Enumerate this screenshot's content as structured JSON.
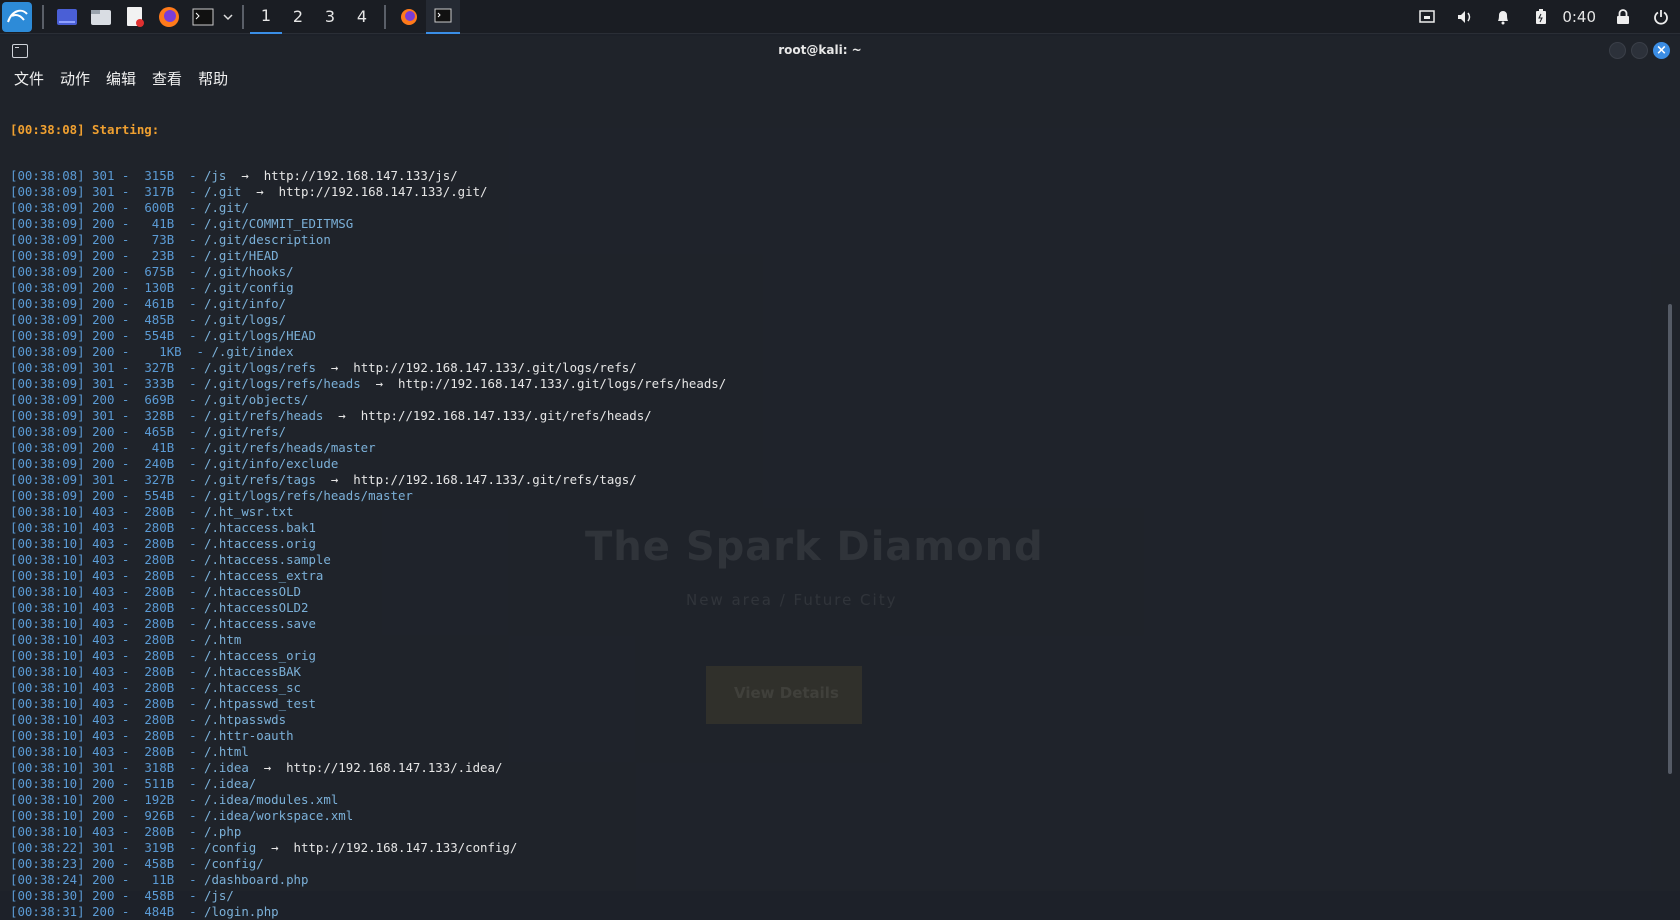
{
  "taskbar": {
    "workspaces": [
      "1",
      "2",
      "3",
      "4"
    ],
    "active_workspace": "1",
    "clock": "0:40",
    "icons": [
      "kali-menu-icon",
      "desktop-icon",
      "file-manager-icon",
      "text-editor-icon",
      "firefox-icon",
      "terminal-icon",
      "dropdown-icon"
    ],
    "tray_icons": [
      "network-icon",
      "volume-icon",
      "notification-icon",
      "battery-icon",
      "lock-icon",
      "power-icon"
    ]
  },
  "window": {
    "title": "root@kali: ~",
    "menu": [
      "文件",
      "动作",
      "编辑",
      "查看",
      "帮助"
    ]
  },
  "terminal": {
    "start_line": "[00:38:08] Starting:",
    "lines": [
      {
        "ts": "[00:38:08]",
        "code": "301",
        "size": " 315B",
        "path": "/js",
        "redirect": "http://192.168.147.133/js/"
      },
      {
        "ts": "[00:38:09]",
        "code": "301",
        "size": " 317B",
        "path": "/.git",
        "redirect": "http://192.168.147.133/.git/"
      },
      {
        "ts": "[00:38:09]",
        "code": "200",
        "size": " 600B",
        "path": "/.git/",
        "redirect": ""
      },
      {
        "ts": "[00:38:09]",
        "code": "200",
        "size": "  41B",
        "path": "/.git/COMMIT_EDITMSG",
        "redirect": ""
      },
      {
        "ts": "[00:38:09]",
        "code": "200",
        "size": "  73B",
        "path": "/.git/description",
        "redirect": ""
      },
      {
        "ts": "[00:38:09]",
        "code": "200",
        "size": "  23B",
        "path": "/.git/HEAD",
        "redirect": ""
      },
      {
        "ts": "[00:38:09]",
        "code": "200",
        "size": " 675B",
        "path": "/.git/hooks/",
        "redirect": ""
      },
      {
        "ts": "[00:38:09]",
        "code": "200",
        "size": " 130B",
        "path": "/.git/config",
        "redirect": ""
      },
      {
        "ts": "[00:38:09]",
        "code": "200",
        "size": " 461B",
        "path": "/.git/info/",
        "redirect": ""
      },
      {
        "ts": "[00:38:09]",
        "code": "200",
        "size": " 485B",
        "path": "/.git/logs/",
        "redirect": ""
      },
      {
        "ts": "[00:38:09]",
        "code": "200",
        "size": " 554B",
        "path": "/.git/logs/HEAD",
        "redirect": ""
      },
      {
        "ts": "[00:38:09]",
        "code": "200",
        "size": "   1KB",
        "path": "/.git/index",
        "redirect": ""
      },
      {
        "ts": "[00:38:09]",
        "code": "301",
        "size": " 327B",
        "path": "/.git/logs/refs",
        "redirect": "http://192.168.147.133/.git/logs/refs/"
      },
      {
        "ts": "[00:38:09]",
        "code": "301",
        "size": " 333B",
        "path": "/.git/logs/refs/heads",
        "redirect": "http://192.168.147.133/.git/logs/refs/heads/"
      },
      {
        "ts": "[00:38:09]",
        "code": "200",
        "size": " 669B",
        "path": "/.git/objects/",
        "redirect": ""
      },
      {
        "ts": "[00:38:09]",
        "code": "301",
        "size": " 328B",
        "path": "/.git/refs/heads",
        "redirect": "http://192.168.147.133/.git/refs/heads/"
      },
      {
        "ts": "[00:38:09]",
        "code": "200",
        "size": " 465B",
        "path": "/.git/refs/",
        "redirect": ""
      },
      {
        "ts": "[00:38:09]",
        "code": "200",
        "size": "  41B",
        "path": "/.git/refs/heads/master",
        "redirect": ""
      },
      {
        "ts": "[00:38:09]",
        "code": "200",
        "size": " 240B",
        "path": "/.git/info/exclude",
        "redirect": ""
      },
      {
        "ts": "[00:38:09]",
        "code": "301",
        "size": " 327B",
        "path": "/.git/refs/tags",
        "redirect": "http://192.168.147.133/.git/refs/tags/"
      },
      {
        "ts": "[00:38:09]",
        "code": "200",
        "size": " 554B",
        "path": "/.git/logs/refs/heads/master",
        "redirect": ""
      },
      {
        "ts": "[00:38:10]",
        "code": "403",
        "size": " 280B",
        "path": "/.ht_wsr.txt",
        "redirect": ""
      },
      {
        "ts": "[00:38:10]",
        "code": "403",
        "size": " 280B",
        "path": "/.htaccess.bak1",
        "redirect": ""
      },
      {
        "ts": "[00:38:10]",
        "code": "403",
        "size": " 280B",
        "path": "/.htaccess.orig",
        "redirect": ""
      },
      {
        "ts": "[00:38:10]",
        "code": "403",
        "size": " 280B",
        "path": "/.htaccess.sample",
        "redirect": ""
      },
      {
        "ts": "[00:38:10]",
        "code": "403",
        "size": " 280B",
        "path": "/.htaccess_extra",
        "redirect": ""
      },
      {
        "ts": "[00:38:10]",
        "code": "403",
        "size": " 280B",
        "path": "/.htaccessOLD",
        "redirect": ""
      },
      {
        "ts": "[00:38:10]",
        "code": "403",
        "size": " 280B",
        "path": "/.htaccessOLD2",
        "redirect": ""
      },
      {
        "ts": "[00:38:10]",
        "code": "403",
        "size": " 280B",
        "path": "/.htaccess.save",
        "redirect": ""
      },
      {
        "ts": "[00:38:10]",
        "code": "403",
        "size": " 280B",
        "path": "/.htm",
        "redirect": ""
      },
      {
        "ts": "[00:38:10]",
        "code": "403",
        "size": " 280B",
        "path": "/.htaccess_orig",
        "redirect": ""
      },
      {
        "ts": "[00:38:10]",
        "code": "403",
        "size": " 280B",
        "path": "/.htaccessBAK",
        "redirect": ""
      },
      {
        "ts": "[00:38:10]",
        "code": "403",
        "size": " 280B",
        "path": "/.htaccess_sc",
        "redirect": ""
      },
      {
        "ts": "[00:38:10]",
        "code": "403",
        "size": " 280B",
        "path": "/.htpasswd_test",
        "redirect": ""
      },
      {
        "ts": "[00:38:10]",
        "code": "403",
        "size": " 280B",
        "path": "/.htpasswds",
        "redirect": ""
      },
      {
        "ts": "[00:38:10]",
        "code": "403",
        "size": " 280B",
        "path": "/.httr-oauth",
        "redirect": ""
      },
      {
        "ts": "[00:38:10]",
        "code": "403",
        "size": " 280B",
        "path": "/.html",
        "redirect": ""
      },
      {
        "ts": "[00:38:10]",
        "code": "301",
        "size": " 318B",
        "path": "/.idea",
        "redirect": "http://192.168.147.133/.idea/"
      },
      {
        "ts": "[00:38:10]",
        "code": "200",
        "size": " 511B",
        "path": "/.idea/",
        "redirect": ""
      },
      {
        "ts": "[00:38:10]",
        "code": "200",
        "size": " 192B",
        "path": "/.idea/modules.xml",
        "redirect": ""
      },
      {
        "ts": "[00:38:10]",
        "code": "200",
        "size": " 926B",
        "path": "/.idea/workspace.xml",
        "redirect": ""
      },
      {
        "ts": "[00:38:10]",
        "code": "403",
        "size": " 280B",
        "path": "/.php",
        "redirect": ""
      },
      {
        "ts": "[00:38:22]",
        "code": "301",
        "size": " 319B",
        "path": "/config",
        "redirect": "http://192.168.147.133/config/"
      },
      {
        "ts": "[00:38:23]",
        "code": "200",
        "size": " 458B",
        "path": "/config/",
        "redirect": ""
      },
      {
        "ts": "[00:38:24]",
        "code": "200",
        "size": "  11B",
        "path": "/dashboard.php",
        "redirect": ""
      },
      {
        "ts": "[00:38:30]",
        "code": "200",
        "size": " 458B",
        "path": "/js/",
        "redirect": ""
      },
      {
        "ts": "[00:38:31]",
        "code": "200",
        "size": " 484B",
        "path": "/login.php",
        "redirect": ""
      }
    ]
  },
  "background_page": {
    "headline": "The Spark Diamond",
    "subtitle": "New area / Future City",
    "button": "View Details"
  },
  "colors": {
    "accent": "#3a8ee6",
    "starting": "#f0a030",
    "log_blue": "#5b9bd5",
    "path": "#7bb0d8"
  }
}
